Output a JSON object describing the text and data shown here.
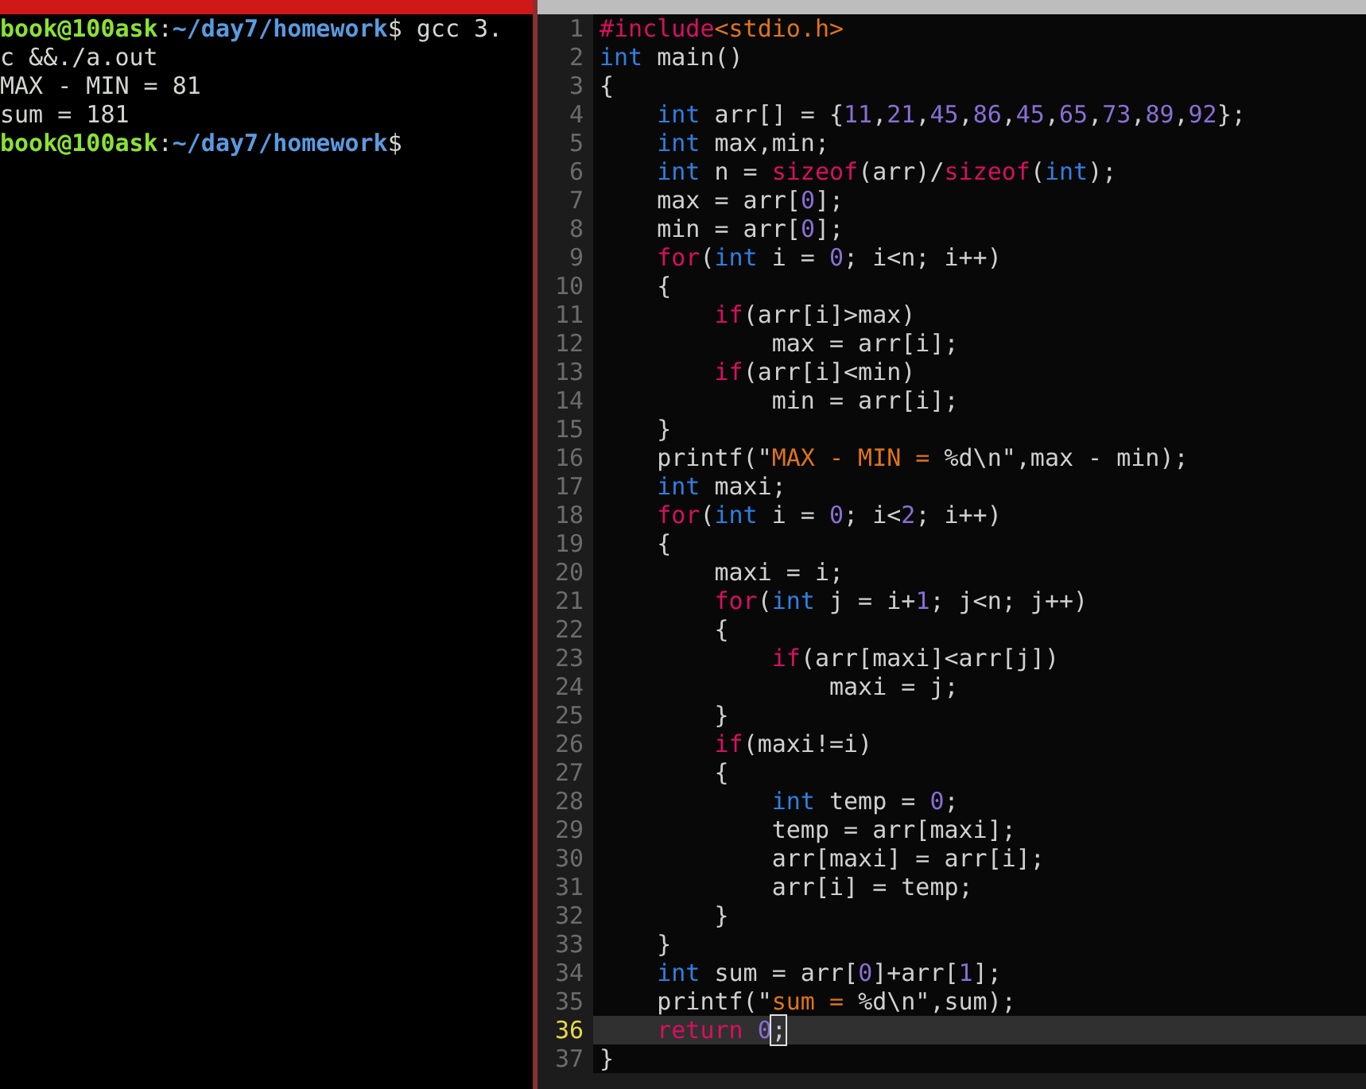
{
  "terminal": {
    "lines": [
      {
        "tokens": [
          {
            "kind": "user",
            "text": "book@100ask"
          },
          {
            "kind": "plain",
            "text": ":"
          },
          {
            "kind": "path",
            "text": "~/day7/homework"
          },
          {
            "kind": "plain",
            "text": "$ gcc 3."
          }
        ]
      },
      {
        "tokens": [
          {
            "kind": "plain",
            "text": "c &&./a.out"
          }
        ]
      },
      {
        "tokens": [
          {
            "kind": "plain",
            "text": "MAX - MIN = 81"
          }
        ]
      },
      {
        "tokens": [
          {
            "kind": "plain",
            "text": "sum = 181"
          }
        ]
      },
      {
        "tokens": [
          {
            "kind": "user",
            "text": "book@100ask"
          },
          {
            "kind": "plain",
            "text": ":"
          },
          {
            "kind": "path",
            "text": "~/day7/homework"
          },
          {
            "kind": "plain",
            "text": "$"
          }
        ]
      }
    ]
  },
  "editor": {
    "lines": [
      {
        "number": "1",
        "current": false,
        "tokens": [
          {
            "kind": "preproc",
            "text": "#include"
          },
          {
            "kind": "string",
            "text": "<stdio.h>"
          }
        ]
      },
      {
        "number": "2",
        "current": false,
        "tokens": [
          {
            "kind": "type",
            "text": "int"
          },
          {
            "kind": "plain",
            "text": " main()"
          }
        ]
      },
      {
        "number": "3",
        "current": false,
        "tokens": [
          {
            "kind": "plain",
            "text": "{"
          }
        ]
      },
      {
        "number": "4",
        "current": false,
        "tokens": [
          {
            "kind": "type",
            "text": "    int"
          },
          {
            "kind": "plain",
            "text": " arr[] = {"
          },
          {
            "kind": "number",
            "text": "11"
          },
          {
            "kind": "plain",
            "text": ","
          },
          {
            "kind": "number",
            "text": "21"
          },
          {
            "kind": "plain",
            "text": ","
          },
          {
            "kind": "number",
            "text": "45"
          },
          {
            "kind": "plain",
            "text": ","
          },
          {
            "kind": "number",
            "text": "86"
          },
          {
            "kind": "plain",
            "text": ","
          },
          {
            "kind": "number",
            "text": "45"
          },
          {
            "kind": "plain",
            "text": ","
          },
          {
            "kind": "number",
            "text": "65"
          },
          {
            "kind": "plain",
            "text": ","
          },
          {
            "kind": "number",
            "text": "73"
          },
          {
            "kind": "plain",
            "text": ","
          },
          {
            "kind": "number",
            "text": "89"
          },
          {
            "kind": "plain",
            "text": ","
          },
          {
            "kind": "number",
            "text": "92"
          },
          {
            "kind": "plain",
            "text": "};"
          }
        ]
      },
      {
        "number": "5",
        "current": false,
        "tokens": [
          {
            "kind": "type",
            "text": "    int"
          },
          {
            "kind": "plain",
            "text": " max,min;"
          }
        ]
      },
      {
        "number": "6",
        "current": false,
        "tokens": [
          {
            "kind": "type",
            "text": "    int"
          },
          {
            "kind": "plain",
            "text": " n = "
          },
          {
            "kind": "keyword",
            "text": "sizeof"
          },
          {
            "kind": "plain",
            "text": "(arr)/"
          },
          {
            "kind": "keyword",
            "text": "sizeof"
          },
          {
            "kind": "plain",
            "text": "("
          },
          {
            "kind": "type",
            "text": "int"
          },
          {
            "kind": "plain",
            "text": ");"
          }
        ]
      },
      {
        "number": "7",
        "current": false,
        "tokens": [
          {
            "kind": "plain",
            "text": "    max = arr["
          },
          {
            "kind": "number",
            "text": "0"
          },
          {
            "kind": "plain",
            "text": "];"
          }
        ]
      },
      {
        "number": "8",
        "current": false,
        "tokens": [
          {
            "kind": "plain",
            "text": "    min = arr["
          },
          {
            "kind": "number",
            "text": "0"
          },
          {
            "kind": "plain",
            "text": "];"
          }
        ]
      },
      {
        "number": "9",
        "current": false,
        "tokens": [
          {
            "kind": "keyword",
            "text": "    for"
          },
          {
            "kind": "plain",
            "text": "("
          },
          {
            "kind": "type",
            "text": "int"
          },
          {
            "kind": "plain",
            "text": " i = "
          },
          {
            "kind": "number",
            "text": "0"
          },
          {
            "kind": "plain",
            "text": "; i<n; i++)"
          }
        ]
      },
      {
        "number": "10",
        "current": false,
        "tokens": [
          {
            "kind": "plain",
            "text": "    {"
          }
        ]
      },
      {
        "number": "11",
        "current": false,
        "tokens": [
          {
            "kind": "keyword",
            "text": "        if"
          },
          {
            "kind": "plain",
            "text": "(arr[i]>max)"
          }
        ]
      },
      {
        "number": "12",
        "current": false,
        "tokens": [
          {
            "kind": "plain",
            "text": "            max = arr[i];"
          }
        ]
      },
      {
        "number": "13",
        "current": false,
        "tokens": [
          {
            "kind": "keyword",
            "text": "        if"
          },
          {
            "kind": "plain",
            "text": "(arr[i]<min)"
          }
        ]
      },
      {
        "number": "14",
        "current": false,
        "tokens": [
          {
            "kind": "plain",
            "text": "            min = arr[i];"
          }
        ]
      },
      {
        "number": "15",
        "current": false,
        "tokens": [
          {
            "kind": "plain",
            "text": "    }"
          }
        ]
      },
      {
        "number": "16",
        "current": false,
        "tokens": [
          {
            "kind": "plain",
            "text": "    printf(\""
          },
          {
            "kind": "string",
            "text": "MAX - MIN = "
          },
          {
            "kind": "plain",
            "text": "%d\\n\",max - min);"
          }
        ]
      },
      {
        "number": "17",
        "current": false,
        "tokens": [
          {
            "kind": "type",
            "text": "    int"
          },
          {
            "kind": "plain",
            "text": " maxi;"
          }
        ]
      },
      {
        "number": "18",
        "current": false,
        "tokens": [
          {
            "kind": "keyword",
            "text": "    for"
          },
          {
            "kind": "plain",
            "text": "("
          },
          {
            "kind": "type",
            "text": "int"
          },
          {
            "kind": "plain",
            "text": " i = "
          },
          {
            "kind": "number",
            "text": "0"
          },
          {
            "kind": "plain",
            "text": "; i<"
          },
          {
            "kind": "number",
            "text": "2"
          },
          {
            "kind": "plain",
            "text": "; i++)"
          }
        ]
      },
      {
        "number": "19",
        "current": false,
        "tokens": [
          {
            "kind": "plain",
            "text": "    {"
          }
        ]
      },
      {
        "number": "20",
        "current": false,
        "tokens": [
          {
            "kind": "plain",
            "text": "        maxi = i;"
          }
        ]
      },
      {
        "number": "21",
        "current": false,
        "tokens": [
          {
            "kind": "keyword",
            "text": "        for"
          },
          {
            "kind": "plain",
            "text": "("
          },
          {
            "kind": "type",
            "text": "int"
          },
          {
            "kind": "plain",
            "text": " j = i+"
          },
          {
            "kind": "number",
            "text": "1"
          },
          {
            "kind": "plain",
            "text": "; j<n; j++)"
          }
        ]
      },
      {
        "number": "22",
        "current": false,
        "tokens": [
          {
            "kind": "plain",
            "text": "        {"
          }
        ]
      },
      {
        "number": "23",
        "current": false,
        "tokens": [
          {
            "kind": "keyword",
            "text": "            if"
          },
          {
            "kind": "plain",
            "text": "(arr[maxi]<arr[j])"
          }
        ]
      },
      {
        "number": "24",
        "current": false,
        "tokens": [
          {
            "kind": "plain",
            "text": "                maxi = j;"
          }
        ]
      },
      {
        "number": "25",
        "current": false,
        "tokens": [
          {
            "kind": "plain",
            "text": "        }"
          }
        ]
      },
      {
        "number": "26",
        "current": false,
        "tokens": [
          {
            "kind": "keyword",
            "text": "        if"
          },
          {
            "kind": "plain",
            "text": "(maxi!=i)"
          }
        ]
      },
      {
        "number": "27",
        "current": false,
        "tokens": [
          {
            "kind": "plain",
            "text": "        {"
          }
        ]
      },
      {
        "number": "28",
        "current": false,
        "tokens": [
          {
            "kind": "type",
            "text": "            int"
          },
          {
            "kind": "plain",
            "text": " temp = "
          },
          {
            "kind": "number",
            "text": "0"
          },
          {
            "kind": "plain",
            "text": ";"
          }
        ]
      },
      {
        "number": "29",
        "current": false,
        "tokens": [
          {
            "kind": "plain",
            "text": "            temp = arr[maxi];"
          }
        ]
      },
      {
        "number": "30",
        "current": false,
        "tokens": [
          {
            "kind": "plain",
            "text": "            arr[maxi] = arr[i];"
          }
        ]
      },
      {
        "number": "31",
        "current": false,
        "tokens": [
          {
            "kind": "plain",
            "text": "            arr[i] = temp;"
          }
        ]
      },
      {
        "number": "32",
        "current": false,
        "tokens": [
          {
            "kind": "plain",
            "text": "        }"
          }
        ]
      },
      {
        "number": "33",
        "current": false,
        "tokens": [
          {
            "kind": "plain",
            "text": "    }"
          }
        ]
      },
      {
        "number": "34",
        "current": false,
        "tokens": [
          {
            "kind": "type",
            "text": "    int"
          },
          {
            "kind": "plain",
            "text": " sum = arr["
          },
          {
            "kind": "number",
            "text": "0"
          },
          {
            "kind": "plain",
            "text": "]+arr["
          },
          {
            "kind": "number",
            "text": "1"
          },
          {
            "kind": "plain",
            "text": "];"
          }
        ]
      },
      {
        "number": "35",
        "current": false,
        "tokens": [
          {
            "kind": "plain",
            "text": "    printf(\""
          },
          {
            "kind": "string",
            "text": "sum = "
          },
          {
            "kind": "plain",
            "text": "%d\\n\",sum);"
          }
        ]
      },
      {
        "number": "36",
        "current": true,
        "tokens": [
          {
            "kind": "keyword",
            "text": "    return "
          },
          {
            "kind": "number",
            "text": "0"
          },
          {
            "kind": "cursor",
            "text": ";"
          }
        ]
      },
      {
        "number": "37",
        "current": false,
        "tokens": [
          {
            "kind": "plain",
            "text": "}"
          }
        ]
      }
    ]
  }
}
